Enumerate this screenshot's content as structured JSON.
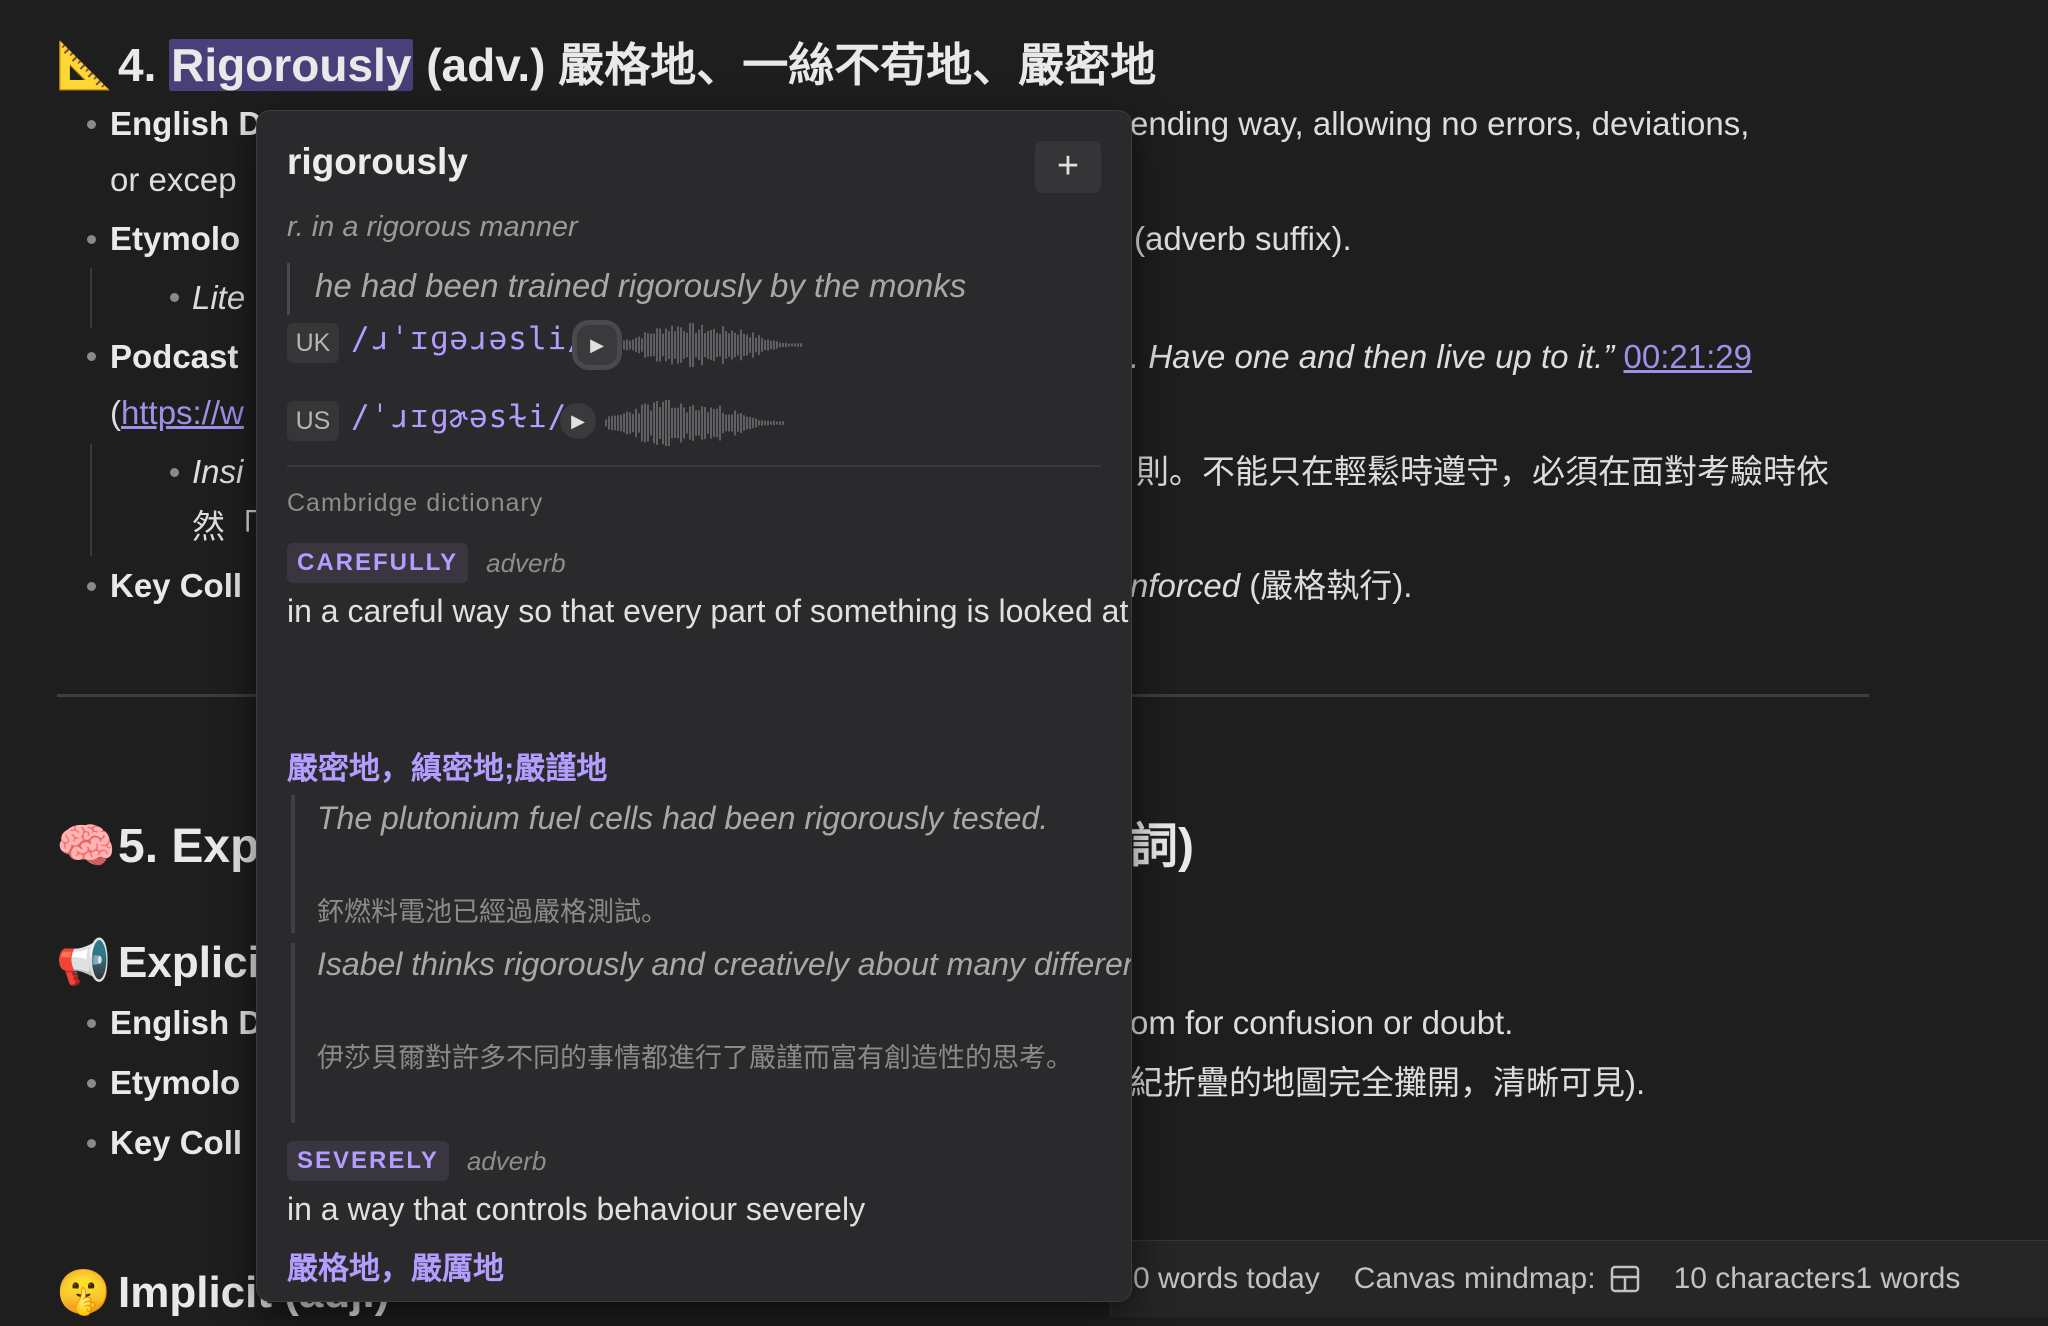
{
  "editor": {
    "h4": {
      "emoji": "📐",
      "number": "4.",
      "word": "Rigorously",
      "rest": "(adv.) 嚴格地、一絲不苟地、嚴密地"
    },
    "line1": {
      "label": "English D",
      "tail": "ending way, allowing no errors, deviations,"
    },
    "line2": {
      "text": "or excep"
    },
    "line3": {
      "label": "Etymolo",
      "tail": "(adverb suffix)."
    },
    "line4": {
      "text": "Lite"
    },
    "line5": {
      "label": "Podcast",
      "quote": ". Have one and then live up to it.”",
      "timestamp": "00:21:29"
    },
    "line6": {
      "paren": "(",
      "link": "https://w"
    },
    "line7": {
      "text": "Insi",
      "tail": "則。不能只在輕鬆時遵守，必須在面對考驗時依"
    },
    "line8": {
      "text": "然「"
    },
    "line9": {
      "label": "Key Coll",
      "tail_italic": "nforced",
      "tail": " (嚴格執行)."
    },
    "h5": {
      "emoji": "🧠",
      "text": "5. Exp",
      "tail": "詞)"
    },
    "hexp": {
      "emoji": "📢",
      "text": "Explici"
    },
    "line10": {
      "label": "English D",
      "tail": "om for confusion or doubt."
    },
    "line11": {
      "label": "Etymolo",
      "tail": "紀折疊的地圖完全攤開，清晰可見)."
    },
    "line12": {
      "label": "Key Coll"
    },
    "himp": {
      "emoji": "🤫",
      "text": "Implicit (adj.)"
    }
  },
  "statusbar": {
    "words_today": "0 words today",
    "canvas_label": "Canvas mindmap:",
    "canvas_icon": "layout-icon",
    "counts": "10 characters1 words"
  },
  "popup": {
    "word": "rigorously",
    "add_label": "+",
    "definition": "r. in a rigorous manner",
    "example": "he had been trained rigorously by the monks",
    "uk": {
      "tag": "UK",
      "ipa": "/ɹˈɪɡəɹəsli/"
    },
    "us": {
      "tag": "US",
      "ipa": "/ˈɹɪɡɚəsɫi/"
    },
    "source": "Cambridge dictionary",
    "senses": [
      {
        "tag": "CAREFULLY",
        "pos": "adverb",
        "text": "in a careful way so that every part of something is looked at or considered to make certain it is correct or safe",
        "zh": "嚴密地，縝密地;嚴謹地",
        "examples": [
          {
            "en": "The plutonium fuel cells had been rigorously tested.",
            "zh": "鈈燃料電池已經過嚴格測試。"
          },
          {
            "en": "Isabel thinks rigorously and creatively about many different things.",
            "zh": "伊莎貝爾對許多不同的事情都進行了嚴謹而富有創造性的思考。"
          }
        ]
      },
      {
        "tag": "SEVERELY",
        "pos": "adverb",
        "text": "in a way that controls behaviour severely",
        "zh": "嚴格地，嚴厲地"
      }
    ]
  }
}
